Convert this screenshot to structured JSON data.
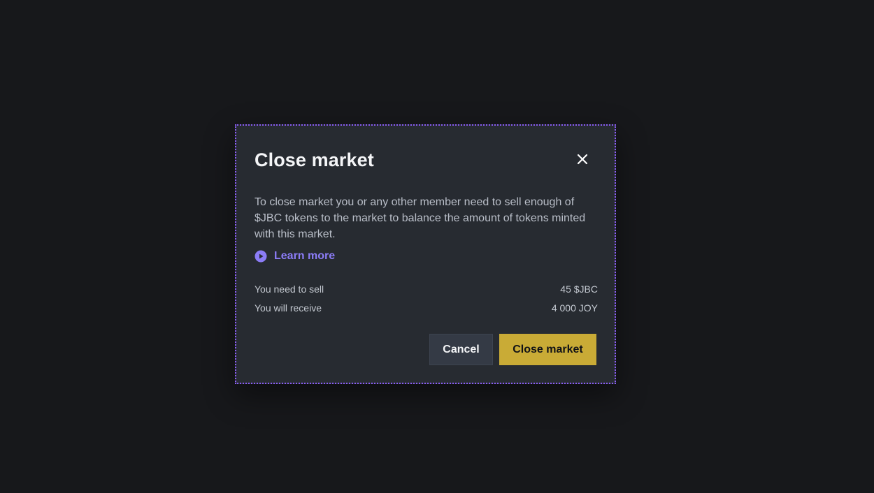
{
  "modal": {
    "title": "Close market",
    "close_icon": "close-icon",
    "description": "To close market you or any other member need to sell enough of $JBC tokens to the market to balance the amount of tokens minted with this market.",
    "learn_more": {
      "icon": "play-circle-icon",
      "label": "Learn more"
    },
    "details": [
      {
        "label": "You need to sell",
        "value": "45 $JBC"
      },
      {
        "label": "You will receive",
        "value": "4 000 JOY"
      }
    ],
    "buttons": {
      "cancel": "Cancel",
      "confirm": "Close market"
    }
  },
  "colors": {
    "background": "#17181b",
    "modal_bg": "#272b31",
    "focus_outline": "#8a5cf6",
    "link": "#8b7cf6",
    "primary_button": "#c9ab36",
    "secondary_button": "#343a45"
  }
}
